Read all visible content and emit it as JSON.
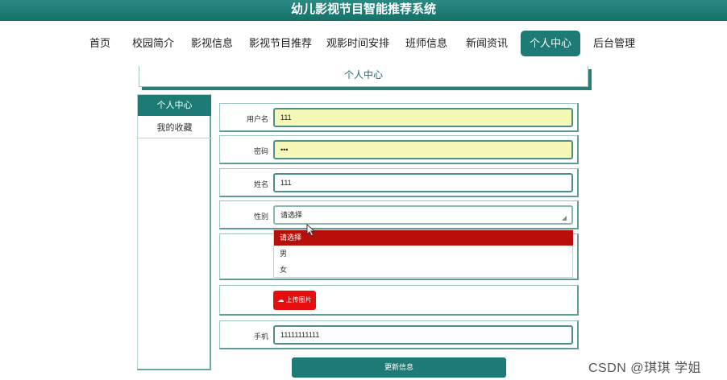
{
  "app": {
    "title": "幼儿影视节目智能推荐系统"
  },
  "nav": {
    "items": [
      {
        "label": "首页"
      },
      {
        "label": "校园简介"
      },
      {
        "label": "影视信息"
      },
      {
        "label": "影视节目推荐"
      },
      {
        "label": "观影时间安排"
      },
      {
        "label": "班师信息"
      },
      {
        "label": "新闻资讯"
      },
      {
        "label": "个人中心"
      },
      {
        "label": "后台管理"
      }
    ],
    "active": "个人中心"
  },
  "section": {
    "title": "个人中心"
  },
  "sidebar": {
    "items": [
      {
        "label": "个人中心"
      },
      {
        "label": "我的收藏"
      }
    ]
  },
  "form": {
    "username": {
      "label": "用户名",
      "value": "111"
    },
    "password": {
      "label": "密码",
      "value": "•••"
    },
    "name": {
      "label": "姓名",
      "value": "111"
    },
    "gender": {
      "label": "性别",
      "value": "请选择",
      "options": [
        "请选择",
        "男",
        "女"
      ]
    },
    "upload": {
      "label": "上传图片"
    },
    "phone": {
      "label": "手机",
      "value": "11111111111"
    },
    "submit": {
      "label": "更新信息"
    }
  },
  "watermark": {
    "text": "CSDN @琪琪 学姐"
  },
  "colors": {
    "primary": "#1d7a74",
    "danger": "#e60e0e",
    "selected_option": "#b80f0a",
    "filled_input": "#f6f8b8"
  }
}
